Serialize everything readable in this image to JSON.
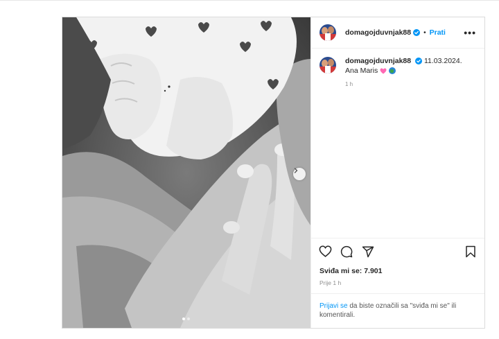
{
  "post": {
    "username": "domagojduvnjak88",
    "follow_label": "Prati",
    "separator": "•",
    "more_label": "•••",
    "caption_date": "11.03.2024.",
    "caption_text": "Ana Maris",
    "caption_time": "1 h",
    "likes": "Sviđa mi se: 7.901",
    "posted_ago": "Prije 1 h",
    "login_link": "Prijavi se",
    "login_text": " da biste označili sa \"sviđa mi se\" ili komentirali.",
    "carousel": {
      "total": 2,
      "current": 1
    }
  },
  "icons": {
    "like": "heart-icon",
    "comment": "comment-icon",
    "share": "share-icon",
    "save": "bookmark-icon",
    "verified": "verified-badge-icon",
    "next": "chevron-right-icon"
  },
  "colors": {
    "link": "#0095f6",
    "verified": "#0095f6",
    "heart_emoji": "#ff69b4"
  }
}
